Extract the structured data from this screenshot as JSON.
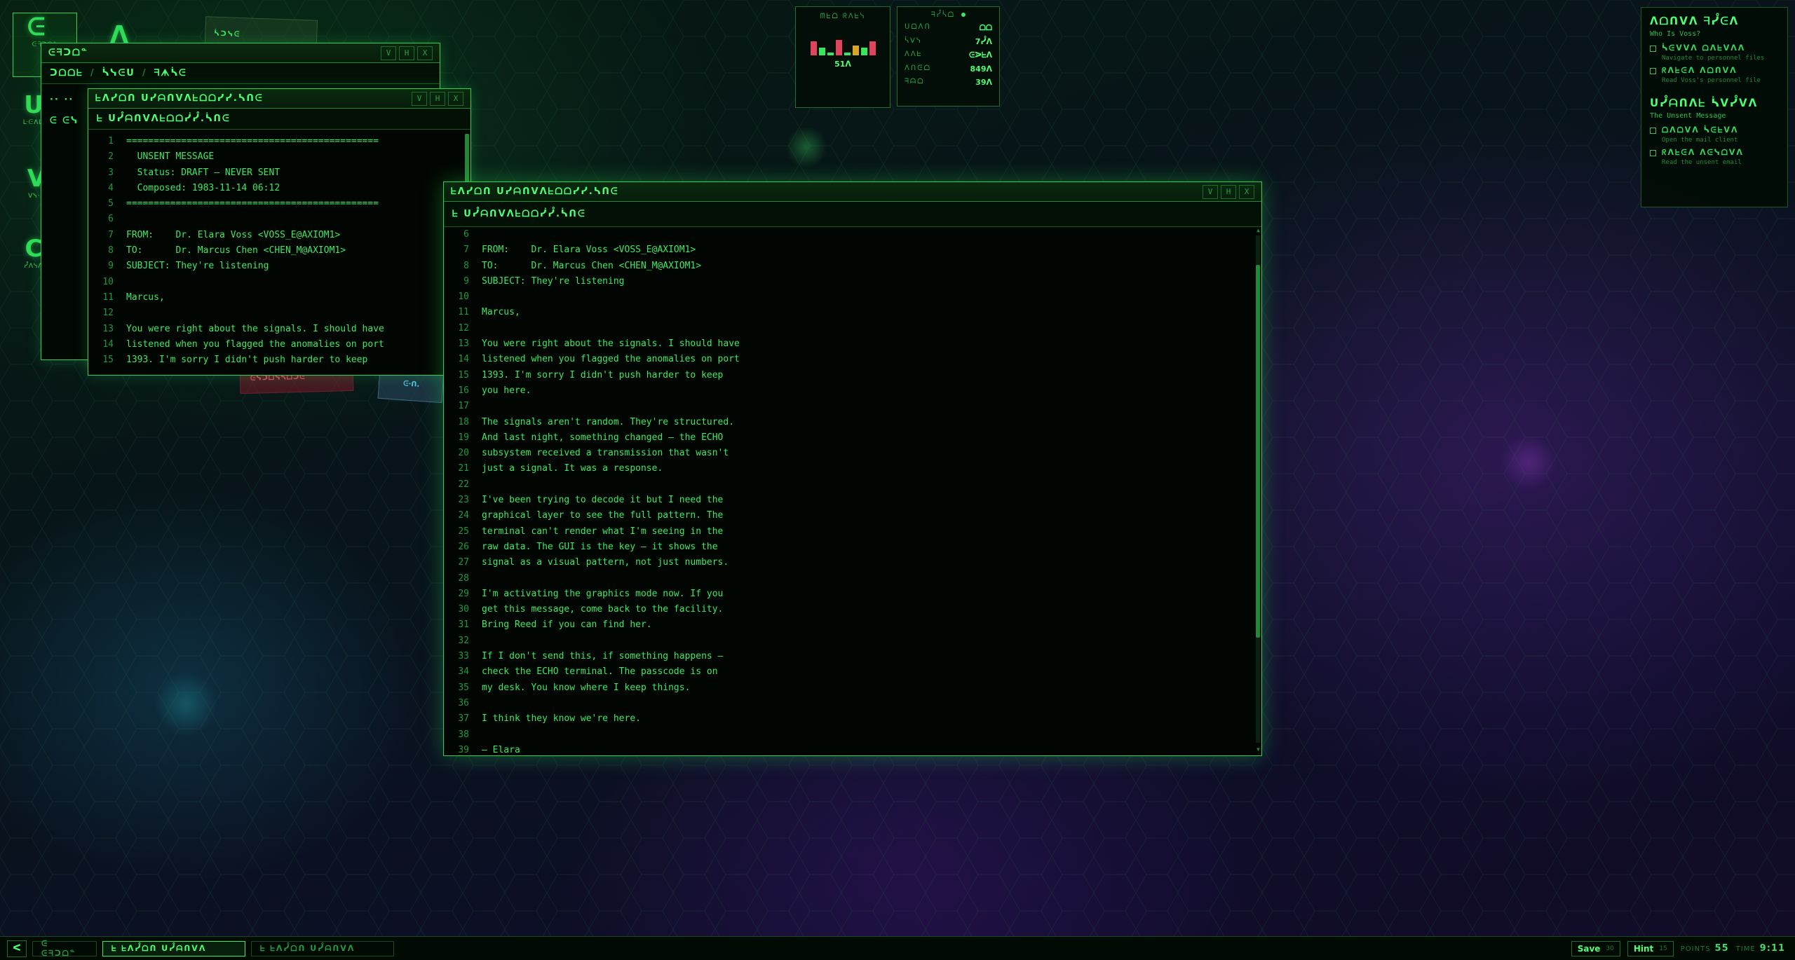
{
  "desktop": {
    "icons": [
      {
        "glyph": "ᕮ",
        "label": "ᕮᖷᑐᗝᓐ"
      },
      {
        "glyph": "ᐱ",
        "label": ""
      },
      {
        "glyph": "ᑌ",
        "label": "ᒷᕮᐱᒷ"
      },
      {
        "glyph": "V",
        "label": "Vᓭ·ᖷ"
      },
      {
        "glyph": "C",
        "label": "ᓮᐱᓭᐱ"
      }
    ],
    "scatter": [
      {
        "text": "ᓵᑐᓭᕮ",
        "color": "#2fbf52"
      },
      {
        "text": "ᕮᓭᑐᗝᓭᓴᗝᑐᕮ",
        "color": "#e0445a"
      },
      {
        "text": "ᕮ·ᑎ.",
        "color": "#4fc4e8"
      }
    ]
  },
  "file_window": {
    "title": "ᕮᖷᑐᗝᓐ",
    "breadcrumb": [
      "ᑐᗝᗝᖶ",
      "ᓵᓭᕮᑌ",
      "ᖷᗗᓵᕮ"
    ],
    "items": [
      "·· ··",
      "ᕮ ᕮᓭ"
    ],
    "buttons": [
      "V",
      "H",
      "X"
    ]
  },
  "mail_back": {
    "title": "ᖶᐱᓮᗝᑎ     ᑌᓮᗩᑎᐯᐱᖶᗝᗝᓰᓮ.ᓵᑎᕮ",
    "toolbar": "ᖶ ᑌᓮᗩᑎᐯᐱᖶᗝᗝᓰᓮ.ᓵᑎᕮ",
    "buttons": [
      "V",
      "H",
      "X"
    ],
    "lines": [
      {
        "n": "1",
        "t": "=============================================="
      },
      {
        "n": "2",
        "t": "  UNSENT MESSAGE"
      },
      {
        "n": "3",
        "t": "  Status: DRAFT — NEVER SENT"
      },
      {
        "n": "4",
        "t": "  Composed: 1983-11-14 06:12"
      },
      {
        "n": "5",
        "t": "=============================================="
      },
      {
        "n": "6",
        "t": ""
      },
      {
        "n": "7",
        "t": "FROM:    Dr. Elara Voss <VOSS_E@AXIOM1>"
      },
      {
        "n": "8",
        "t": "TO:      Dr. Marcus Chen <CHEN_M@AXIOM1>"
      },
      {
        "n": "9",
        "t": "SUBJECT: They're listening"
      },
      {
        "n": "10",
        "t": ""
      },
      {
        "n": "11",
        "t": "Marcus,"
      },
      {
        "n": "12",
        "t": ""
      },
      {
        "n": "13",
        "t": "You were right about the signals. I should have"
      },
      {
        "n": "14",
        "t": "listened when you flagged the anomalies on port"
      },
      {
        "n": "15",
        "t": "1393. I'm sorry I didn't push harder to keep"
      }
    ]
  },
  "mail_front": {
    "title": "ᖶᐱᓮᗝᑎ     ᑌᓮᗩᑎᐯᐱᖶᗝᗝᓰᓮ.ᓵᑎᕮ",
    "toolbar": "ᖶ ᑌᓮᗩᑎᐯᐱᖶᗝᗝᓰᓮ.ᓵᑎᕮ",
    "buttons": [
      "V",
      "H",
      "X"
    ],
    "lines": [
      {
        "n": "6",
        "t": ""
      },
      {
        "n": "7",
        "t": "FROM:    Dr. Elara Voss <VOSS_E@AXIOM1>"
      },
      {
        "n": "8",
        "t": "TO:      Dr. Marcus Chen <CHEN_M@AXIOM1>"
      },
      {
        "n": "9",
        "t": "SUBJECT: They're listening"
      },
      {
        "n": "10",
        "t": ""
      },
      {
        "n": "11",
        "t": "Marcus,"
      },
      {
        "n": "12",
        "t": ""
      },
      {
        "n": "13",
        "t": "You were right about the signals. I should have"
      },
      {
        "n": "14",
        "t": "listened when you flagged the anomalies on port"
      },
      {
        "n": "15",
        "t": "1393. I'm sorry I didn't push harder to keep"
      },
      {
        "n": "16",
        "t": "you here."
      },
      {
        "n": "17",
        "t": ""
      },
      {
        "n": "18",
        "t": "The signals aren't random. They're structured."
      },
      {
        "n": "19",
        "t": "And last night, something changed — the ECHO"
      },
      {
        "n": "20",
        "t": "subsystem received a transmission that wasn't"
      },
      {
        "n": "21",
        "t": "just a signal. It was a response."
      },
      {
        "n": "22",
        "t": ""
      },
      {
        "n": "23",
        "t": "I've been trying to decode it but I need the"
      },
      {
        "n": "24",
        "t": "graphical layer to see the full pattern. The"
      },
      {
        "n": "25",
        "t": "terminal can't render what I'm seeing in the"
      },
      {
        "n": "26",
        "t": "raw data. The GUI is the key — it shows the"
      },
      {
        "n": "27",
        "t": "signal as a visual pattern, not just numbers."
      },
      {
        "n": "28",
        "t": ""
      },
      {
        "n": "29",
        "t": "I'm activating the graphics mode now. If you"
      },
      {
        "n": "30",
        "t": "get this message, come back to the facility."
      },
      {
        "n": "31",
        "t": "Bring Reed if you can find her."
      },
      {
        "n": "32",
        "t": ""
      },
      {
        "n": "33",
        "t": "If I don't send this, if something happens —"
      },
      {
        "n": "34",
        "t": "check the ECHO terminal. The passcode is on"
      },
      {
        "n": "35",
        "t": "my desk. You know where I keep things."
      },
      {
        "n": "36",
        "t": ""
      },
      {
        "n": "37",
        "t": "I think they know we're here."
      },
      {
        "n": "38",
        "t": ""
      },
      {
        "n": "39",
        "t": "— Elara"
      }
    ],
    "scroll_fraction": 0.22
  },
  "signal_panel": {
    "label": "ᗰᖶᗝ ᖇᐱᖶᓭ",
    "value": "51ᐱ",
    "bars": [
      {
        "level": 0.55,
        "color": "#e0445a"
      },
      {
        "level": 0.3,
        "color": "#39e75f"
      },
      {
        "level": 0.12,
        "color": "#39e75f"
      },
      {
        "level": 0.62,
        "color": "#e0445a"
      },
      {
        "level": 0.1,
        "color": "#39e75f"
      },
      {
        "level": 0.4,
        "color": "#d9a62a"
      },
      {
        "level": 0.3,
        "color": "#39e75f"
      },
      {
        "level": 0.55,
        "color": "#e0445a"
      }
    ]
  },
  "stats_panel": {
    "header": "ᖷᓮᓵᗝ",
    "rows": [
      {
        "k": "ᑌᗝᐱᑎ",
        "v": "ᗝᗝ"
      },
      {
        "k": "ᓵᐯᓭ",
        "v": "7ᓮᐱ"
      },
      {
        "k": "ᐱᐱᖶ",
        "v": "ᕮᐷᖶᐱ"
      },
      {
        "k": "ᐱᑎᕮᗝ",
        "v": "849ᐱ"
      },
      {
        "k": "ᖷᗩᗝ",
        "v": "39ᐱ"
      }
    ]
  },
  "tasks": {
    "sections": [
      {
        "heading": "ᐱᗝᑎᐯᐱ ᖷᓮᕮᐱ",
        "subtitle": "Who Is Voss?",
        "items": [
          {
            "label": "ᓵᕮᐯᐯᐱ ᗝᐱᖶᐯᐱᐱ",
            "desc": "Navigate to personnel files"
          },
          {
            "label": "ᖇᐱᖶᕮᐱ ᐱᗝᑎᐯᐱ",
            "desc": "Read Voss's personnel file"
          }
        ]
      },
      {
        "heading": "ᑌᓮᗩᑎᐱᖶ ᓵᐯᓮᐯᐱ",
        "subtitle": "The Unsent Message",
        "items": [
          {
            "label": "ᗝᐱᗝᐯᐱ ᓵᕮᖶᐯᐱ",
            "desc": "Open the mail client"
          },
          {
            "label": "ᖇᐱᖶᕮᐱ ᐱᕮᓭᗝᐯᐱ",
            "desc": "Read the unsent email"
          }
        ]
      }
    ]
  },
  "taskbar": {
    "start": "ᐸ",
    "items": [
      {
        "label": "ᕮ ᕮᖷᑐᗝᓐ",
        "active": false
      },
      {
        "label": "ᖶ ᖶᐱᓮᗝᑎ     ᑌᓮᗩᑎᐯᐱ",
        "active": true
      },
      {
        "label": "ᖶ ᖶᐱᓮᗝᑎ     ᑌᓮᗩᑎᐯᐱ",
        "active": false
      }
    ],
    "save_label": "Save",
    "save_key": "30",
    "hint_label": "Hint",
    "hint_key": "15",
    "points_label": "POINTS",
    "points_value": "55",
    "time_label": "TIME",
    "time_value": "9:11"
  }
}
